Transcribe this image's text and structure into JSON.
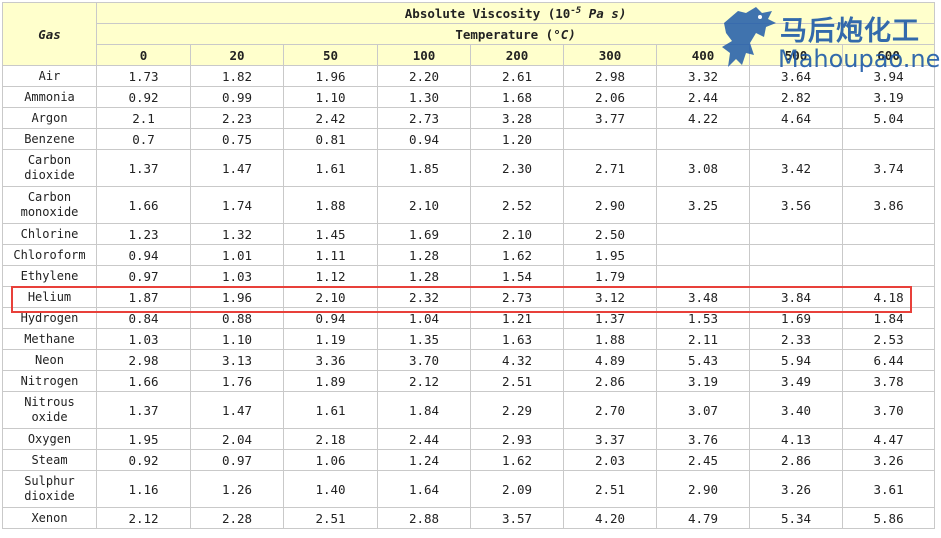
{
  "header": {
    "gas_label": "Gas",
    "title": "Absolute Viscosity (10",
    "title_exp": "-5",
    "title_unit": " Pa s)",
    "temperature_label": "Temperature (",
    "temperature_unit": "°C)"
  },
  "columns": [
    "0",
    "20",
    "50",
    "100",
    "200",
    "300",
    "400",
    "500",
    "600"
  ],
  "rows": [
    {
      "gas": "Air",
      "values": [
        "1.73",
        "1.82",
        "1.96",
        "2.20",
        "2.61",
        "2.98",
        "3.32",
        "3.64",
        "3.94"
      ]
    },
    {
      "gas": "Ammonia",
      "values": [
        "0.92",
        "0.99",
        "1.10",
        "1.30",
        "1.68",
        "2.06",
        "2.44",
        "2.82",
        "3.19"
      ]
    },
    {
      "gas": "Argon",
      "values": [
        "2.1",
        "2.23",
        "2.42",
        "2.73",
        "3.28",
        "3.77",
        "4.22",
        "4.64",
        "5.04"
      ]
    },
    {
      "gas": "Benzene",
      "values": [
        "0.7",
        "0.75",
        "0.81",
        "0.94",
        "1.20",
        "",
        "",
        "",
        ""
      ]
    },
    {
      "gas": "Carbon dioxide",
      "values": [
        "1.37",
        "1.47",
        "1.61",
        "1.85",
        "2.30",
        "2.71",
        "3.08",
        "3.42",
        "3.74"
      ]
    },
    {
      "gas": "Carbon monoxide",
      "values": [
        "1.66",
        "1.74",
        "1.88",
        "2.10",
        "2.52",
        "2.90",
        "3.25",
        "3.56",
        "3.86"
      ]
    },
    {
      "gas": "Chlorine",
      "values": [
        "1.23",
        "1.32",
        "1.45",
        "1.69",
        "2.10",
        "2.50",
        "",
        "",
        ""
      ]
    },
    {
      "gas": "Chloroform",
      "values": [
        "0.94",
        "1.01",
        "1.11",
        "1.28",
        "1.62",
        "1.95",
        "",
        "",
        ""
      ]
    },
    {
      "gas": "Ethylene",
      "values": [
        "0.97",
        "1.03",
        "1.12",
        "1.28",
        "1.54",
        "1.79",
        "",
        "",
        ""
      ]
    },
    {
      "gas": "Helium",
      "values": [
        "1.87",
        "1.96",
        "2.10",
        "2.32",
        "2.73",
        "3.12",
        "3.48",
        "3.84",
        "4.18"
      ]
    },
    {
      "gas": "Hydrogen",
      "values": [
        "0.84",
        "0.88",
        "0.94",
        "1.04",
        "1.21",
        "1.37",
        "1.53",
        "1.69",
        "1.84"
      ]
    },
    {
      "gas": "Methane",
      "values": [
        "1.03",
        "1.10",
        "1.19",
        "1.35",
        "1.63",
        "1.88",
        "2.11",
        "2.33",
        "2.53"
      ]
    },
    {
      "gas": "Neon",
      "values": [
        "2.98",
        "3.13",
        "3.36",
        "3.70",
        "4.32",
        "4.89",
        "5.43",
        "5.94",
        "6.44"
      ]
    },
    {
      "gas": "Nitrogen",
      "values": [
        "1.66",
        "1.76",
        "1.89",
        "2.12",
        "2.51",
        "2.86",
        "3.19",
        "3.49",
        "3.78"
      ]
    },
    {
      "gas": "Nitrous oxide",
      "values": [
        "1.37",
        "1.47",
        "1.61",
        "1.84",
        "2.29",
        "2.70",
        "3.07",
        "3.40",
        "3.70"
      ]
    },
    {
      "gas": "Oxygen",
      "values": [
        "1.95",
        "2.04",
        "2.18",
        "2.44",
        "2.93",
        "3.37",
        "3.76",
        "4.13",
        "4.47"
      ]
    },
    {
      "gas": "Steam",
      "values": [
        "0.92",
        "0.97",
        "1.06",
        "1.24",
        "1.62",
        "2.03",
        "2.45",
        "2.86",
        "3.26"
      ]
    },
    {
      "gas": "Sulphur dioxide",
      "values": [
        "1.16",
        "1.26",
        "1.40",
        "1.64",
        "2.09",
        "2.51",
        "2.90",
        "3.26",
        "3.61"
      ]
    },
    {
      "gas": "Xenon",
      "values": [
        "2.12",
        "2.28",
        "2.51",
        "2.88",
        "3.57",
        "4.20",
        "4.79",
        "5.34",
        "5.86"
      ]
    }
  ],
  "highlighted_row": "Helium",
  "watermark": {
    "brand": "马后炮化工",
    "url": "Mahoupao.net",
    "icon": "horse-logo-icon"
  },
  "colors": {
    "header_bg": "#ffffcc",
    "highlight": "#e8403a",
    "watermark": "#1e5aa8"
  }
}
